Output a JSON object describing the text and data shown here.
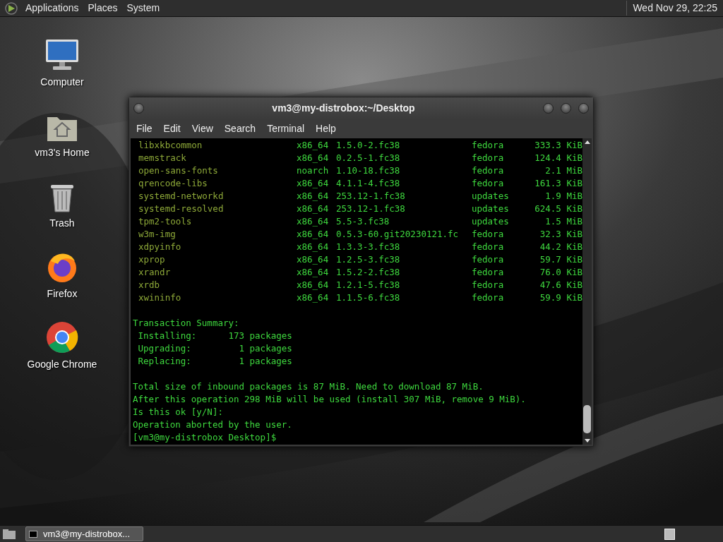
{
  "top_panel": {
    "menus": [
      "Applications",
      "Places",
      "System"
    ],
    "clock": "Wed Nov 29, 22:25"
  },
  "desktop_icons": [
    {
      "kind": "computer",
      "label": "Computer"
    },
    {
      "kind": "home",
      "label": "vm3's Home"
    },
    {
      "kind": "trash",
      "label": "Trash"
    },
    {
      "kind": "fox",
      "label": "Firefox"
    },
    {
      "kind": "chrome",
      "label": "Google Chrome"
    }
  ],
  "terminal": {
    "title": "vm3@my-distrobox:~/Desktop",
    "menu": [
      "File",
      "Edit",
      "View",
      "Search",
      "Terminal",
      "Help"
    ],
    "packages": [
      {
        "name": "libxkbcommon",
        "arch": "x86_64",
        "version": "1.5.0-2.fc38",
        "repo": "fedora",
        "size": "333.3 KiB"
      },
      {
        "name": "memstrack",
        "arch": "x86_64",
        "version": "0.2.5-1.fc38",
        "repo": "fedora",
        "size": "124.4 KiB"
      },
      {
        "name": "open-sans-fonts",
        "arch": "noarch",
        "version": "1.10-18.fc38",
        "repo": "fedora",
        "size": "2.1 MiB"
      },
      {
        "name": "qrencode-libs",
        "arch": "x86_64",
        "version": "4.1.1-4.fc38",
        "repo": "fedora",
        "size": "161.3 KiB"
      },
      {
        "name": "systemd-networkd",
        "arch": "x86_64",
        "version": "253.12-1.fc38",
        "repo": "updates",
        "size": "1.9 MiB"
      },
      {
        "name": "systemd-resolved",
        "arch": "x86_64",
        "version": "253.12-1.fc38",
        "repo": "updates",
        "size": "624.5 KiB"
      },
      {
        "name": "tpm2-tools",
        "arch": "x86_64",
        "version": "5.5-3.fc38",
        "repo": "updates",
        "size": "1.5 MiB"
      },
      {
        "name": "w3m-img",
        "arch": "x86_64",
        "version": "0.5.3-60.git20230121.fc",
        "repo": "fedora",
        "size": "32.3 KiB"
      },
      {
        "name": "xdpyinfo",
        "arch": "x86_64",
        "version": "1.3.3-3.fc38",
        "repo": "fedora",
        "size": "44.2 KiB"
      },
      {
        "name": "xprop",
        "arch": "x86_64",
        "version": "1.2.5-3.fc38",
        "repo": "fedora",
        "size": "59.7 KiB"
      },
      {
        "name": "xrandr",
        "arch": "x86_64",
        "version": "1.5.2-2.fc38",
        "repo": "fedora",
        "size": "76.0 KiB"
      },
      {
        "name": "xrdb",
        "arch": "x86_64",
        "version": "1.2.1-5.fc38",
        "repo": "fedora",
        "size": "47.6 KiB"
      },
      {
        "name": "xwininfo",
        "arch": "x86_64",
        "version": "1.1.5-6.fc38",
        "repo": "fedora",
        "size": "59.9 KiB"
      }
    ],
    "summary": [
      "Transaction Summary:",
      " Installing:      173 packages",
      " Upgrading:         1 packages",
      " Replacing:         1 packages"
    ],
    "messages": [
      "Total size of inbound packages is 87 MiB. Need to download 87 MiB.",
      "After this operation 298 MiB will be used (install 307 MiB, remove 9 MiB).",
      "Is this ok [y/N]:",
      "Operation aborted by the user.",
      "[vm3@my-distrobox Desktop]$"
    ]
  },
  "taskbar": {
    "tasks": [
      {
        "label": "vm3@my-distrobox...",
        "selected": true
      }
    ]
  }
}
